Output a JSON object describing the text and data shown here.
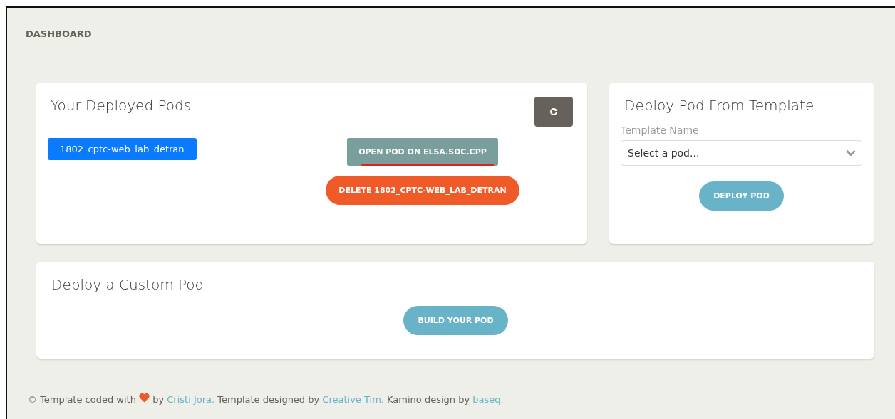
{
  "header": {
    "title": "DASHBOARD"
  },
  "deployed_pods": {
    "title": "Your Deployed Pods",
    "pods": [
      {
        "name": "1802_cptc-web_lab_detran",
        "selected": true
      }
    ],
    "open_button": "OPEN POD ON ELSA.SDC.CPP",
    "delete_button": "DELETE 1802_CPTC-WEB_LAB_DETRAN"
  },
  "template": {
    "title": "Deploy Pod From Template",
    "field_label": "Template Name",
    "select": {
      "value": "Select a pod..."
    },
    "button": "DEPLOY POD"
  },
  "custom": {
    "title": "Deploy a Custom Pod",
    "button": "BUILD YOUR POD"
  },
  "footer": {
    "parts": [
      {
        "kind": "text",
        "text": "© Template coded with"
      },
      {
        "kind": "heart"
      },
      {
        "kind": "text",
        "text": "by"
      },
      {
        "kind": "link",
        "text": "Cristi Jora."
      },
      {
        "kind": "text",
        "text": "Template designed by"
      },
      {
        "kind": "link",
        "text": "Creative Tim."
      },
      {
        "kind": "text",
        "text": "Kamino design by"
      },
      {
        "kind": "link",
        "text": "baseq."
      }
    ]
  }
}
